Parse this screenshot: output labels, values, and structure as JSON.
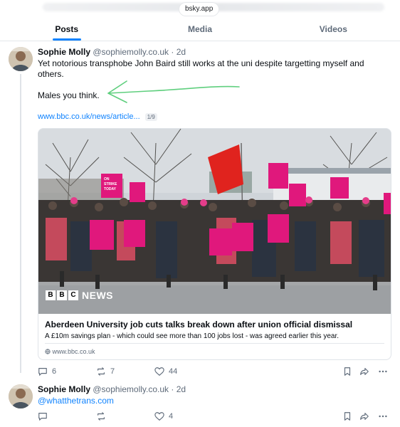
{
  "browser": {
    "domain": "bsky.app"
  },
  "tabs": [
    "Posts",
    "Media",
    "Videos"
  ],
  "post1": {
    "author_name": "Sophie Molly",
    "author_handle": "@sophiemolly.co.uk",
    "time": " · 2d",
    "line1": "Yet notorious transphobe John Baird still works at the uni despite targetting myself and",
    "line2": "others.",
    "line3": "Males you think.",
    "link_text": "www.bbc.co.uk/news/article...",
    "link_counter": "1/9",
    "card": {
      "logo_text": "NEWS",
      "title": "Aberdeen University job cuts talks break down after union official dismissal",
      "description": "A £10m savings plan - which could see more than 100 jobs lost - was agreed earlier this year.",
      "domain": "www.bbc.co.uk",
      "sign_text": [
        "ON",
        "STRIKE",
        "TODAY"
      ]
    },
    "replies": "6",
    "reposts": "7",
    "likes": "44"
  },
  "post2": {
    "author_name": "Sophie Molly",
    "author_handle": "@sophiemolly.co.uk",
    "time": " · 2d",
    "text": "@whatthetrans.com",
    "replies": "",
    "reposts": "",
    "likes": "4"
  },
  "colors": {
    "accent": "#1083fe",
    "muted": "#5f6b7a",
    "annotation": "#5fcf7e",
    "banner": "#e0187c"
  },
  "icons": [
    "reply-icon",
    "repost-icon",
    "like-icon",
    "bookmark-icon",
    "share-icon",
    "more-icon",
    "globe-icon"
  ]
}
